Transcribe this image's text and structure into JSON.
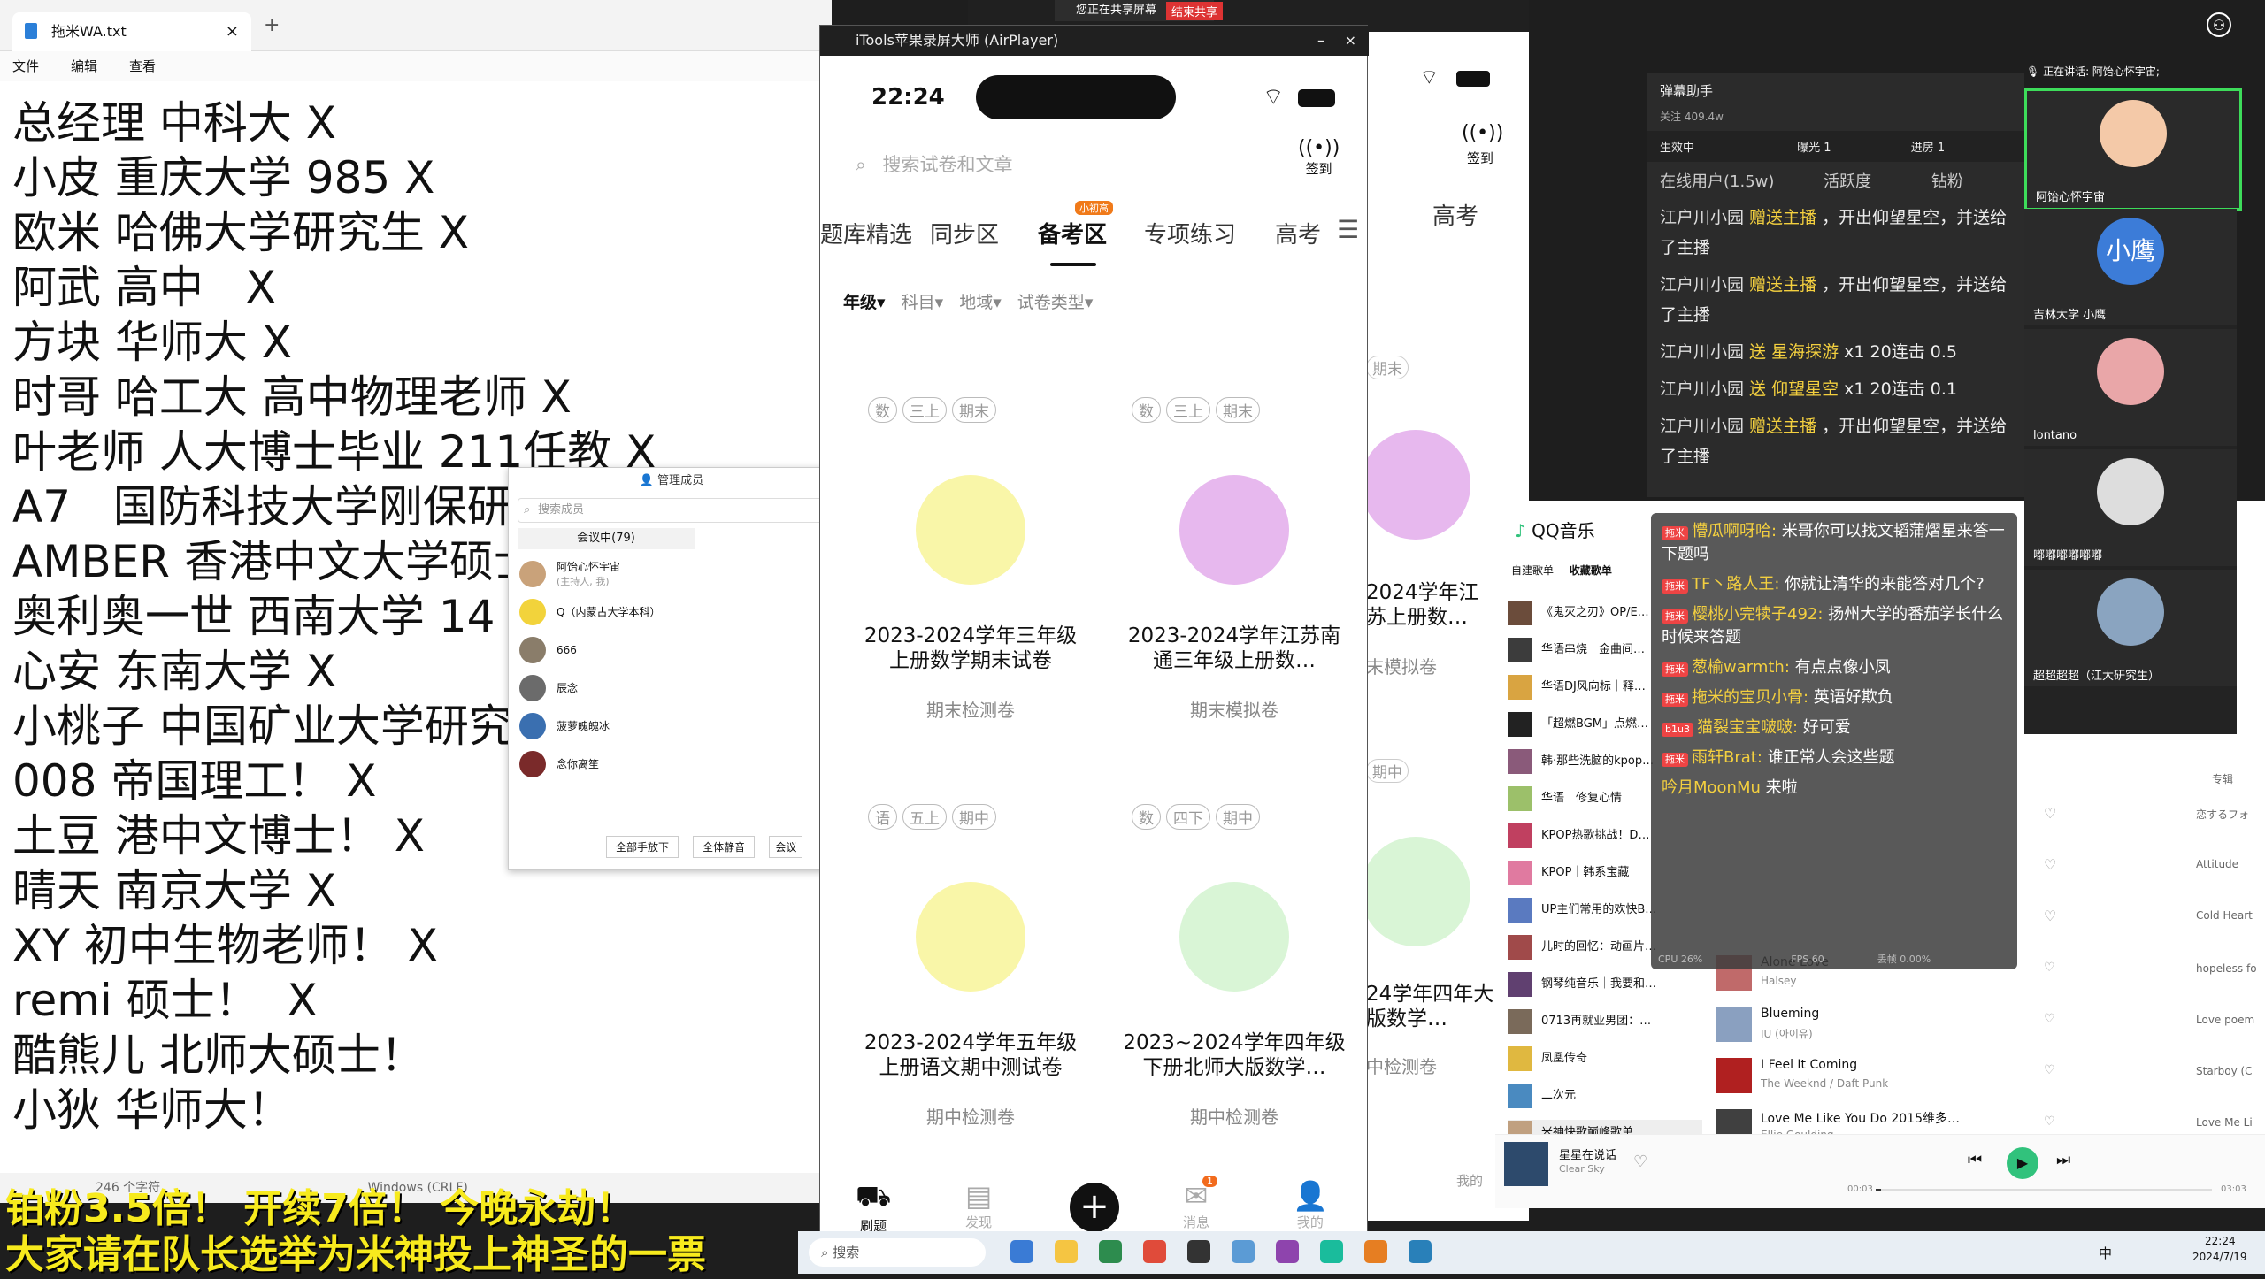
{
  "notepad": {
    "tab_title": "拖米WA.txt",
    "menu": [
      "文件",
      "编辑",
      "查看"
    ],
    "lines": [
      "总经理 中科大 X",
      "小皮 重庆大学 985 X",
      "欧米 哈佛大学研究生 X",
      "阿武 高中   X",
      "方块 华师大 X",
      "时哥 哈工大 高中物理老师 X",
      "叶老师 人大博士毕业 211任教 X",
      "A7   国防科技大学刚保研",
      "AMBER 香港中文大学硕士",
      "奥利奥一世 西南大学 14",
      "心安 东南大学 X",
      "小桃子 中国矿业大学研究生",
      "008 帝国理工！ X",
      "土豆 港中文博士！ X",
      "晴天 南京大学 X",
      "XY 初中生物老师！ X",
      "remi 硕士！  X",
      "酷熊儿 北师大硕士！",
      "小狄 华师大！"
    ],
    "status_chars": "246 个字符",
    "status_encoding": "Windows (CRLF)"
  },
  "overlay": {
    "line1": "铂粉3.5倍！ 开续7倍！ 今晚永劫！",
    "line2": "大家请在队长选举为米神投上神圣的一票"
  },
  "members_panel": {
    "title": "管理成员",
    "search_placeholder": "搜索成员",
    "in_meeting": "会议中(79)",
    "members": [
      {
        "name": "阿饴心怀宇宙",
        "sub": "(主持人, 我)"
      },
      {
        "name": "Q（内蒙古大学本科）",
        "sub": ""
      },
      {
        "name": "666",
        "sub": ""
      },
      {
        "name": "辰念",
        "sub": ""
      },
      {
        "name": "菠萝魄魄冰",
        "sub": ""
      },
      {
        "name": "念你离笙",
        "sub": ""
      }
    ],
    "btn_mute_all_hands": "全部手放下",
    "btn_mute_all": "全体静音",
    "btn_more": "会议"
  },
  "screen_share_bar": {
    "status": "您正在共享屏幕",
    "stop": "结束共享"
  },
  "itools": {
    "title": "iTools苹果录屏大师 (AirPlayer)",
    "time": "22:24",
    "search_placeholder": "搜索试卷和文章",
    "signin": "签到",
    "tabs": [
      "题库精选",
      "同步区",
      "备考区",
      "专项练习",
      "高考"
    ],
    "active_tab_badge": "小初高",
    "filters": [
      "年级",
      "科目",
      "地域",
      "试卷类型"
    ],
    "cards": [
      {
        "tags": [
          "数",
          "三上",
          "期末"
        ],
        "title": "2023-2024学年三年级上册数学期末试卷",
        "sub": "期末检测卷",
        "color": "#f9f6a8"
      },
      {
        "tags": [
          "数",
          "三上",
          "期末"
        ],
        "title": "2023-2024学年江苏南通三年级上册数…",
        "sub": "期末模拟卷",
        "color": "#e7b8ee"
      },
      {
        "tags": [
          "语",
          "五上",
          "期中"
        ],
        "title": "2023-2024学年五年级上册语文期中测试卷",
        "sub": "期中检测卷",
        "color": "#f9f6a8"
      },
      {
        "tags": [
          "数",
          "四下",
          "期中"
        ],
        "title": "2023~2024学年四年级下册北师大版数学…",
        "sub": "期中检测卷",
        "color": "#d9f5d6"
      }
    ],
    "bottom_nav": [
      "刷题",
      "发现",
      "",
      "消息",
      "我的"
    ],
    "msg_badge": "1"
  },
  "bgphone": {
    "signin": "签到",
    "tab_partial": "高考",
    "sub1": "末模拟卷",
    "sub2": "中检测卷",
    "title1": "2024学年江苏上册数…",
    "title2": "24学年四年大版数学…",
    "tag1": "期末",
    "tag2": "期中",
    "bottom": "我的"
  },
  "danmaku": {
    "title": "弹幕助手",
    "followers": "关注 409.4w",
    "tabs": [
      "生效中",
      "曝光 1",
      "进房 1"
    ],
    "online": "在线用户(1.5w)",
    "activity": "活跃度",
    "diamond": "钻粉",
    "lines": [
      {
        "user": "江户川小园",
        "action": " 赠送主播 ",
        "rest": "，开出仰望星空，并送给了主播"
      },
      {
        "user": "江户川小园",
        "action": " 赠送主播 ",
        "rest": "，开出仰望星空，并送给了主播"
      },
      {
        "user": "江户川小园",
        "action": " 送 星海探游 ",
        "rest": "x1 20连击  0.5"
      },
      {
        "user": "江户川小园",
        "action": " 送 仰望星空 ",
        "rest": "x1 20连击  0.1"
      },
      {
        "user": "江户川小园",
        "action": " 赠送主播 ",
        "rest": "，开出仰望星空，并送给了主播"
      }
    ]
  },
  "chat": {
    "lines": [
      {
        "badge": "拖米",
        "user": "懵瓜啊呀哈:",
        "text": "米哥你可以找文韬蒲熠星来答一下题吗"
      },
      {
        "badge": "拖米",
        "user": "TF丶路人王:",
        "text": "你就让清华的来能答对几个?"
      },
      {
        "badge": "拖米",
        "user": "樱桃小完犊子492:",
        "text": "扬州大学的番茄学长什么时候来答题"
      },
      {
        "badge": "拖米",
        "user": "葱榆warmth:",
        "text": "有点点像小凤"
      },
      {
        "badge": "拖米",
        "user": "拖米的宝贝小骨:",
        "text": "英语好欺负"
      },
      {
        "badge": "b1u3",
        "user": "猫裂宝宝啵啵:",
        "text": "好可爱"
      },
      {
        "badge": "拖米",
        "user": "雨轩Brat:",
        "text": "谁正常人会这些题"
      },
      {
        "badge": "",
        "user": "吟月MoonMu",
        "text": "来啦"
      }
    ],
    "cpu": "CPU 26%",
    "fps": "FPS 60",
    "drop": "丢帧 0.00%"
  },
  "qqmusic": {
    "title": "QQ音乐",
    "tabs": [
      "自建歌单",
      "收藏歌单"
    ],
    "playlists": [
      "《鬼灭之刃》OP/E…",
      "华语串烧｜金曲间…",
      "华语DJ风向标｜释…",
      "「超燃BGM」点燃…",
      "韩·那些洗脑的kpop…",
      "华语｜修复心情",
      "KPOP热歌挑战！D…",
      "KPOP｜韩系宝藏",
      "UP主们常用的欢快B…",
      "儿时的回忆：动画片…",
      "钢琴纯音乐｜我要和…",
      "0713再就业男团：…",
      "凤凰传奇",
      "二次元",
      "米神快歌巅峰歌单"
    ],
    "songs": [
      {
        "title": "Alone Love",
        "artist": "Halsey",
        "album": "hopeless fo"
      },
      {
        "title": "Blueming",
        "artist": "IU (아이유)",
        "album": "Love poem"
      },
      {
        "title": "I Feel It Coming",
        "artist": "The Weeknd / Daft Punk",
        "album": "Starboy (C"
      },
      {
        "title": "Love Me Like You Do 2015维多…",
        "artist": "Ellie Goulding",
        "album": "Love Me Li"
      }
    ],
    "right_albums": [
      "恋するフォ",
      "Attitude",
      "Cold Heart"
    ],
    "right_header": "专辑",
    "now_playing_title": "星星在说话",
    "now_playing_artist": "Clear Sky",
    "time_start": "00:03",
    "time_end": "03:03"
  },
  "video_side": {
    "speaking": "正在讲话: 阿饴心怀宇宙;",
    "participants": [
      "阿饴心怀宇宙",
      "吉林大学 小鹰",
      "lontano",
      "嘟嘟嘟嘟嘟嘟",
      "超超超超（江大研究生）"
    ],
    "avatar_text": "小鹰"
  },
  "taskbar": {
    "search": "搜索",
    "time": "22:24",
    "date": "2024/7/19",
    "lang": "中"
  },
  "colors": {
    "overlay_yellow": "#f7ea1d",
    "gift_yellow": "#f4d03f",
    "qq_green": "#31c27c"
  }
}
